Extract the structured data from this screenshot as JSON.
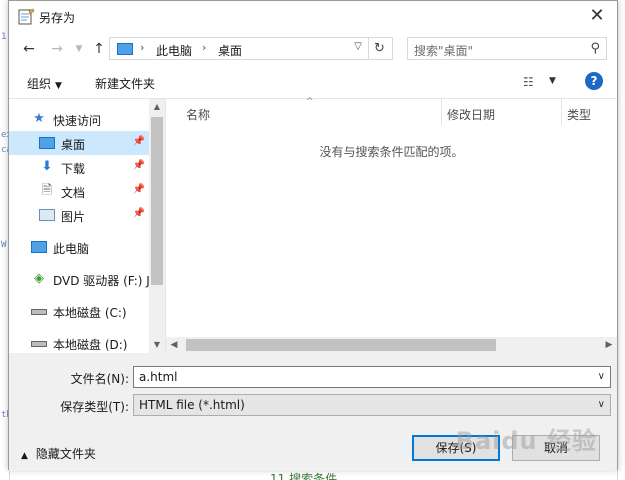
{
  "window": {
    "title": "另存为"
  },
  "address": {
    "crumbs": [
      "此电脑",
      "桌面"
    ]
  },
  "search": {
    "placeholder": "搜索\"桌面\""
  },
  "toolbar": {
    "organize": "组织",
    "new_folder": "新建文件夹"
  },
  "nav": {
    "items": [
      {
        "label": "快速访问",
        "icon": "star-icon"
      },
      {
        "label": "桌面",
        "icon": "desktop-icon",
        "selected": true
      },
      {
        "label": "下载",
        "icon": "download-icon"
      },
      {
        "label": "文档",
        "icon": "document-icon"
      },
      {
        "label": "图片",
        "icon": "pictures-icon"
      },
      {
        "label": "此电脑",
        "icon": "computer-icon"
      },
      {
        "label": "DVD 驱动器 (F:) J",
        "icon": "dvd-drive-icon"
      },
      {
        "label": "本地磁盘 (C:)",
        "icon": "disk-icon"
      },
      {
        "label": "本地磁盘 (D:)",
        "icon": "disk-icon"
      }
    ]
  },
  "columns": [
    "名称",
    "修改日期",
    "类型"
  ],
  "empty_message": "没有与搜索条件匹配的项。",
  "form": {
    "filename_label": "文件名(N):",
    "filename_value": "a.html",
    "filetype_label": "保存类型(T):",
    "filetype_value": "HTML file (*.html)",
    "hide_folders": "隐藏文件夹",
    "save_button": "保存(S)",
    "cancel_button": "取消"
  },
  "background": {
    "bottom_text": "11 搜索条件"
  },
  "watermark": "Baidu 经验",
  "colors": {
    "accent": "#0078d7",
    "selected": "#cce8ff",
    "help": "#1c67c7"
  }
}
